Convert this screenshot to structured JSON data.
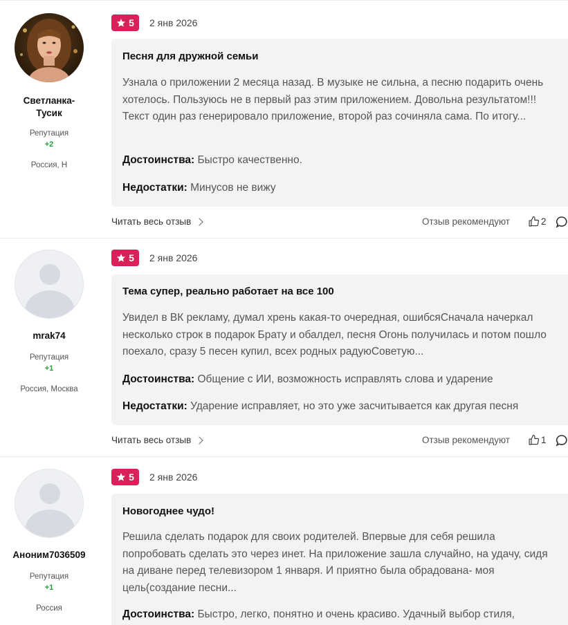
{
  "reviews": [
    {
      "author": {
        "name_line1": "Светланка-",
        "name_line2": "Тусик",
        "avatar": "user-photo-avatar",
        "reputation_label": "Репутация",
        "reputation_value": "+2",
        "location": "Россия, Н"
      },
      "rating": "5",
      "date": "2 янв 2026",
      "title": "Песня для дружной семьи",
      "text": "Узнала о приложении 2 месяца назад. В музыке не сильна, а песню подарить очень хотелось. Пользуюсь не в первый раз этим приложением. Довольна результатом!!! Текст один раз генерировало приложение, второй раз сочиняла сама. По итогу...",
      "pros_label": "Достоинства:",
      "pros": "Быстро качественно.",
      "cons_label": "Недостатки:",
      "cons": "Минусов не вижу",
      "read_more": "Читать весь отзыв",
      "recommend": "Отзыв рекомендуют",
      "likes": "2"
    },
    {
      "author": {
        "name_line1": "mrak74",
        "avatar": "default-avatar",
        "reputation_label": "Репутация",
        "reputation_value": "+1",
        "location": "Россия, Москва"
      },
      "rating": "5",
      "date": "2 янв 2026",
      "title": "Тема супер, реально работает на все 100",
      "text": "Увидел в ВК рекламу, думал хрень какая-то очередная, ошибсяСначала начеркал несколько строк в подарок Брату и обалдел, песня Огонь получилась и потом пошло поехало, сразу 5 песен купил, всех родных радуюСоветую...",
      "pros_label": "Достоинства:",
      "pros": "Общение с ИИ, возможность исправлять слова и ударение",
      "cons_label": "Недостатки:",
      "cons": "Ударение исправляет, но это уже засчитывается как другая песня",
      "read_more": "Читать весь отзыв",
      "recommend": "Отзыв рекомендуют",
      "likes": "1"
    },
    {
      "author": {
        "name_line1": "Аноним7036509",
        "avatar": "default-avatar",
        "reputation_label": "Репутация",
        "reputation_value": "+1",
        "location": "Россия"
      },
      "rating": "5",
      "date": "2 янв 2026",
      "title": "Новогоднее чудо!",
      "text": "Решила сделать подарок для своих родителей. Впервые для себя решила попробовать сделать это через инет. На приложение зашла случайно, на удачу, сидя на диване перед телевизором 1 января. И приятно была обрадована- моя цель(создание песни...",
      "pros_label": "Достоинства:",
      "pros": "Быстро, легко, понятно и очень красиво. Удачный выбор стиля,"
    }
  ],
  "colors": {
    "badge": "#d8215b",
    "reputation": "#1e9e3a",
    "box": "#f2f3f5"
  },
  "icons": {
    "rating": "star-icon",
    "like": "thumbs-up-icon",
    "comment": "comment-icon",
    "read_more": "chevron-right-icon"
  }
}
